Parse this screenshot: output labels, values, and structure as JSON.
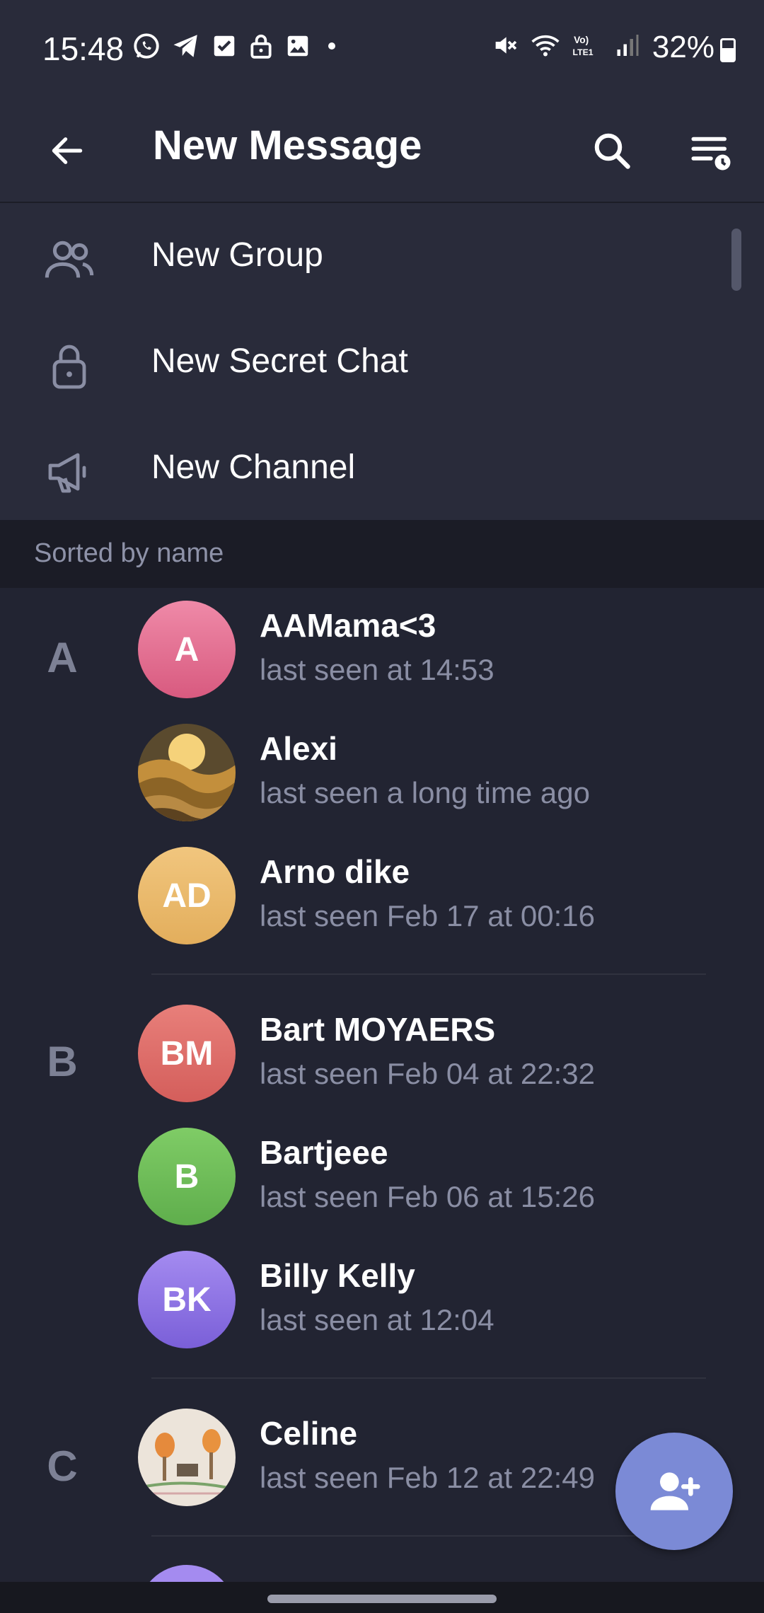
{
  "status_bar": {
    "time": "15:48",
    "battery": "32%",
    "left_icons": [
      "whatsapp-icon",
      "telegram-icon",
      "checkbox-icon",
      "lock-icon",
      "image-icon",
      "dot-icon"
    ],
    "right_icons": [
      "mute-icon",
      "wifi-icon",
      "volte-icon",
      "signal-icon"
    ]
  },
  "app_bar": {
    "title": "New Message",
    "back_icon": "arrow-back-icon",
    "search_icon": "search-icon",
    "sort_icon": "sort-clock-icon"
  },
  "menu": [
    {
      "label": "New Group",
      "icon": "group-icon"
    },
    {
      "label": "New Secret Chat",
      "icon": "lock-icon"
    },
    {
      "label": "New Channel",
      "icon": "megaphone-icon"
    }
  ],
  "sort_header": "Sorted by name",
  "sections": [
    {
      "letter": "A"
    },
    {
      "letter": "B"
    },
    {
      "letter": "C"
    }
  ],
  "contacts": [
    {
      "name": "AAMama<3",
      "status": "last seen at 14:53",
      "initials": "A",
      "color": "#e06a8e"
    },
    {
      "name": "Alexi",
      "status": "last seen a long time ago",
      "initials": "",
      "color": "#c99a3a"
    },
    {
      "name": "Arno dike",
      "status": "last seen Feb 17 at 00:16",
      "initials": "AD",
      "color": "#e8b86a"
    },
    {
      "name": "Bart MOYAERS",
      "status": "last seen Feb 04 at 22:32",
      "initials": "BM",
      "color": "#dc6b68"
    },
    {
      "name": "Bartjeee",
      "status": "last seen Feb 06 at 15:26",
      "initials": "B",
      "color": "#6ebd59"
    },
    {
      "name": "Billy Kelly",
      "status": "last seen at 12:04",
      "initials": "BK",
      "color": "#8a6fe0"
    },
    {
      "name": "Celine",
      "status": "last seen Feb 12 at 22:49",
      "initials": "",
      "color": "#e9dfd6"
    }
  ],
  "fab": {
    "icon": "add-contact-icon",
    "color": "#7b8ad6"
  }
}
